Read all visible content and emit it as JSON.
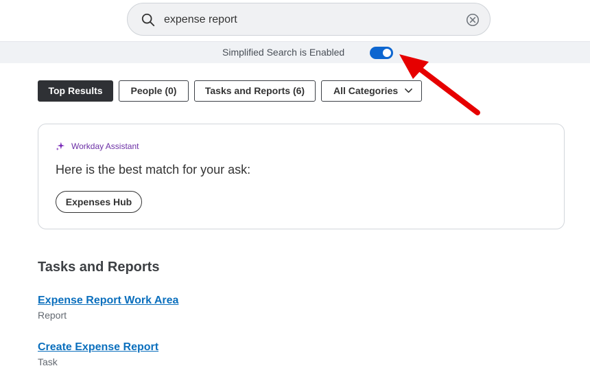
{
  "search": {
    "query": "expense report",
    "search_icon": "search-icon",
    "clear_icon": "clear-circle-x-icon"
  },
  "simplified_search": {
    "label": "Simplified Search is Enabled",
    "toggle_state": "on",
    "toggle_color": "#0d66d0"
  },
  "annotation": {
    "arrow_color": "#e60000",
    "icon": "red-arrow-annotation"
  },
  "tabs": [
    {
      "label": "Top Results",
      "active": true
    },
    {
      "label": "People (0)",
      "active": false
    },
    {
      "label": "Tasks and Reports (6)",
      "active": false
    },
    {
      "label": "All Categories",
      "active": false,
      "icon": "chevron-down-icon"
    }
  ],
  "assistant": {
    "label": "Workday Assistant",
    "label_color": "#6b2fa5",
    "icon": "sparkle-icon",
    "heading": "Here is the best match for your ask:",
    "button_label": "Expenses Hub"
  },
  "tasks_and_reports": {
    "title": "Tasks and Reports",
    "results": [
      {
        "title": "Expense Report Work Area",
        "type": "Report"
      },
      {
        "title": "Create Expense Report",
        "type": "Task"
      }
    ]
  },
  "colors": {
    "active_tab_bg": "#2f3135",
    "link": "#0b6fbd"
  }
}
